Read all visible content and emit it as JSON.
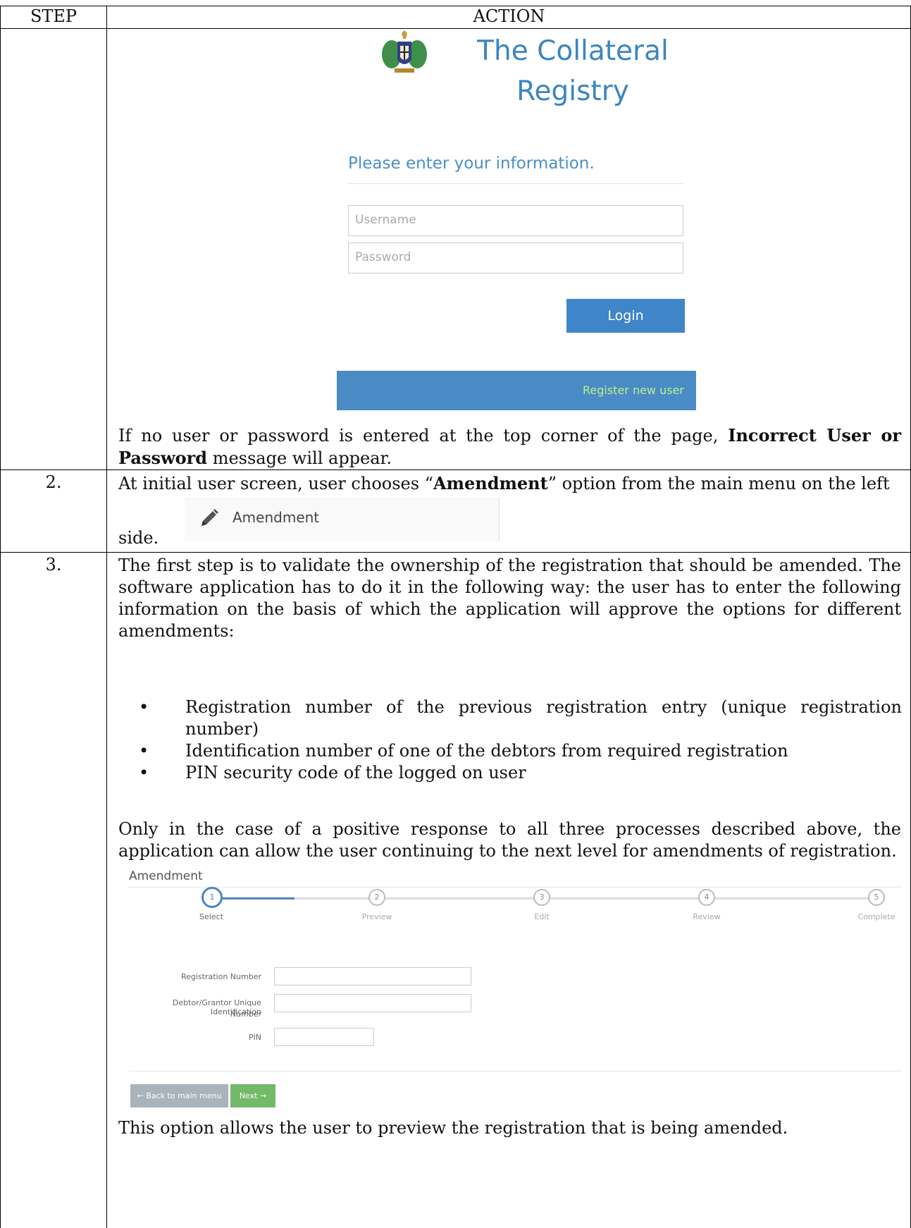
{
  "table": {
    "header_step": "STEP",
    "header_action": "ACTION"
  },
  "login": {
    "title_line1": "The Collateral",
    "title_line2": "Registry",
    "prompt": "Please enter your information.",
    "username_placeholder": "Username",
    "password_placeholder": "Password",
    "login_button": "Login",
    "register_link": "Register new user"
  },
  "step1": {
    "text_before": "If no user or password is entered at the top corner of the page, ",
    "text_bold": "Incorrect User or Password",
    "text_after": " message will appear."
  },
  "step2": {
    "number": "2.",
    "text_before": "At initial user screen, user chooses “",
    "text_bold": "Amendment",
    "text_after": "” option from the main menu on the left",
    "text_line2": "side.",
    "menu_label": "Amendment"
  },
  "step3": {
    "number": "3.",
    "intro": "The first step is to validate the ownership of the registration that should be amended. The software application has to do it in the following way: the user has to enter the following information on the basis of which the application will approve the options for different amendments:",
    "bullets": [
      "Registration number of the previous registration entry (unique registration number)",
      "Identification number of one of the debtors from required registration",
      "PIN security code of the logged on user"
    ],
    "conclusion": "Only in the case of a positive response to all three processes described above, the application can allow the user continuing to the next level for amendments of registration.",
    "wizard": {
      "title": "Amendment",
      "steps": [
        {
          "num": "1",
          "label": "Select"
        },
        {
          "num": "2",
          "label": "Preview"
        },
        {
          "num": "3",
          "label": "Edit"
        },
        {
          "num": "4",
          "label": "Review"
        },
        {
          "num": "5",
          "label": "Complete"
        }
      ],
      "field_registration": "Registration Number",
      "field_debtor_line1": "Debtor/Grantor Unique Identification",
      "field_debtor_line2": "Number",
      "field_pin": "PIN",
      "back_button": "← Back to main menu",
      "next_button": "Next →"
    },
    "preview_note": "This option allows the user to preview the registration that is being amended."
  },
  "colors": {
    "brand_blue": "#3a86c0",
    "button_blue": "#3e86c7",
    "next_green": "#74b86a",
    "back_grey": "#a9b3bc"
  }
}
